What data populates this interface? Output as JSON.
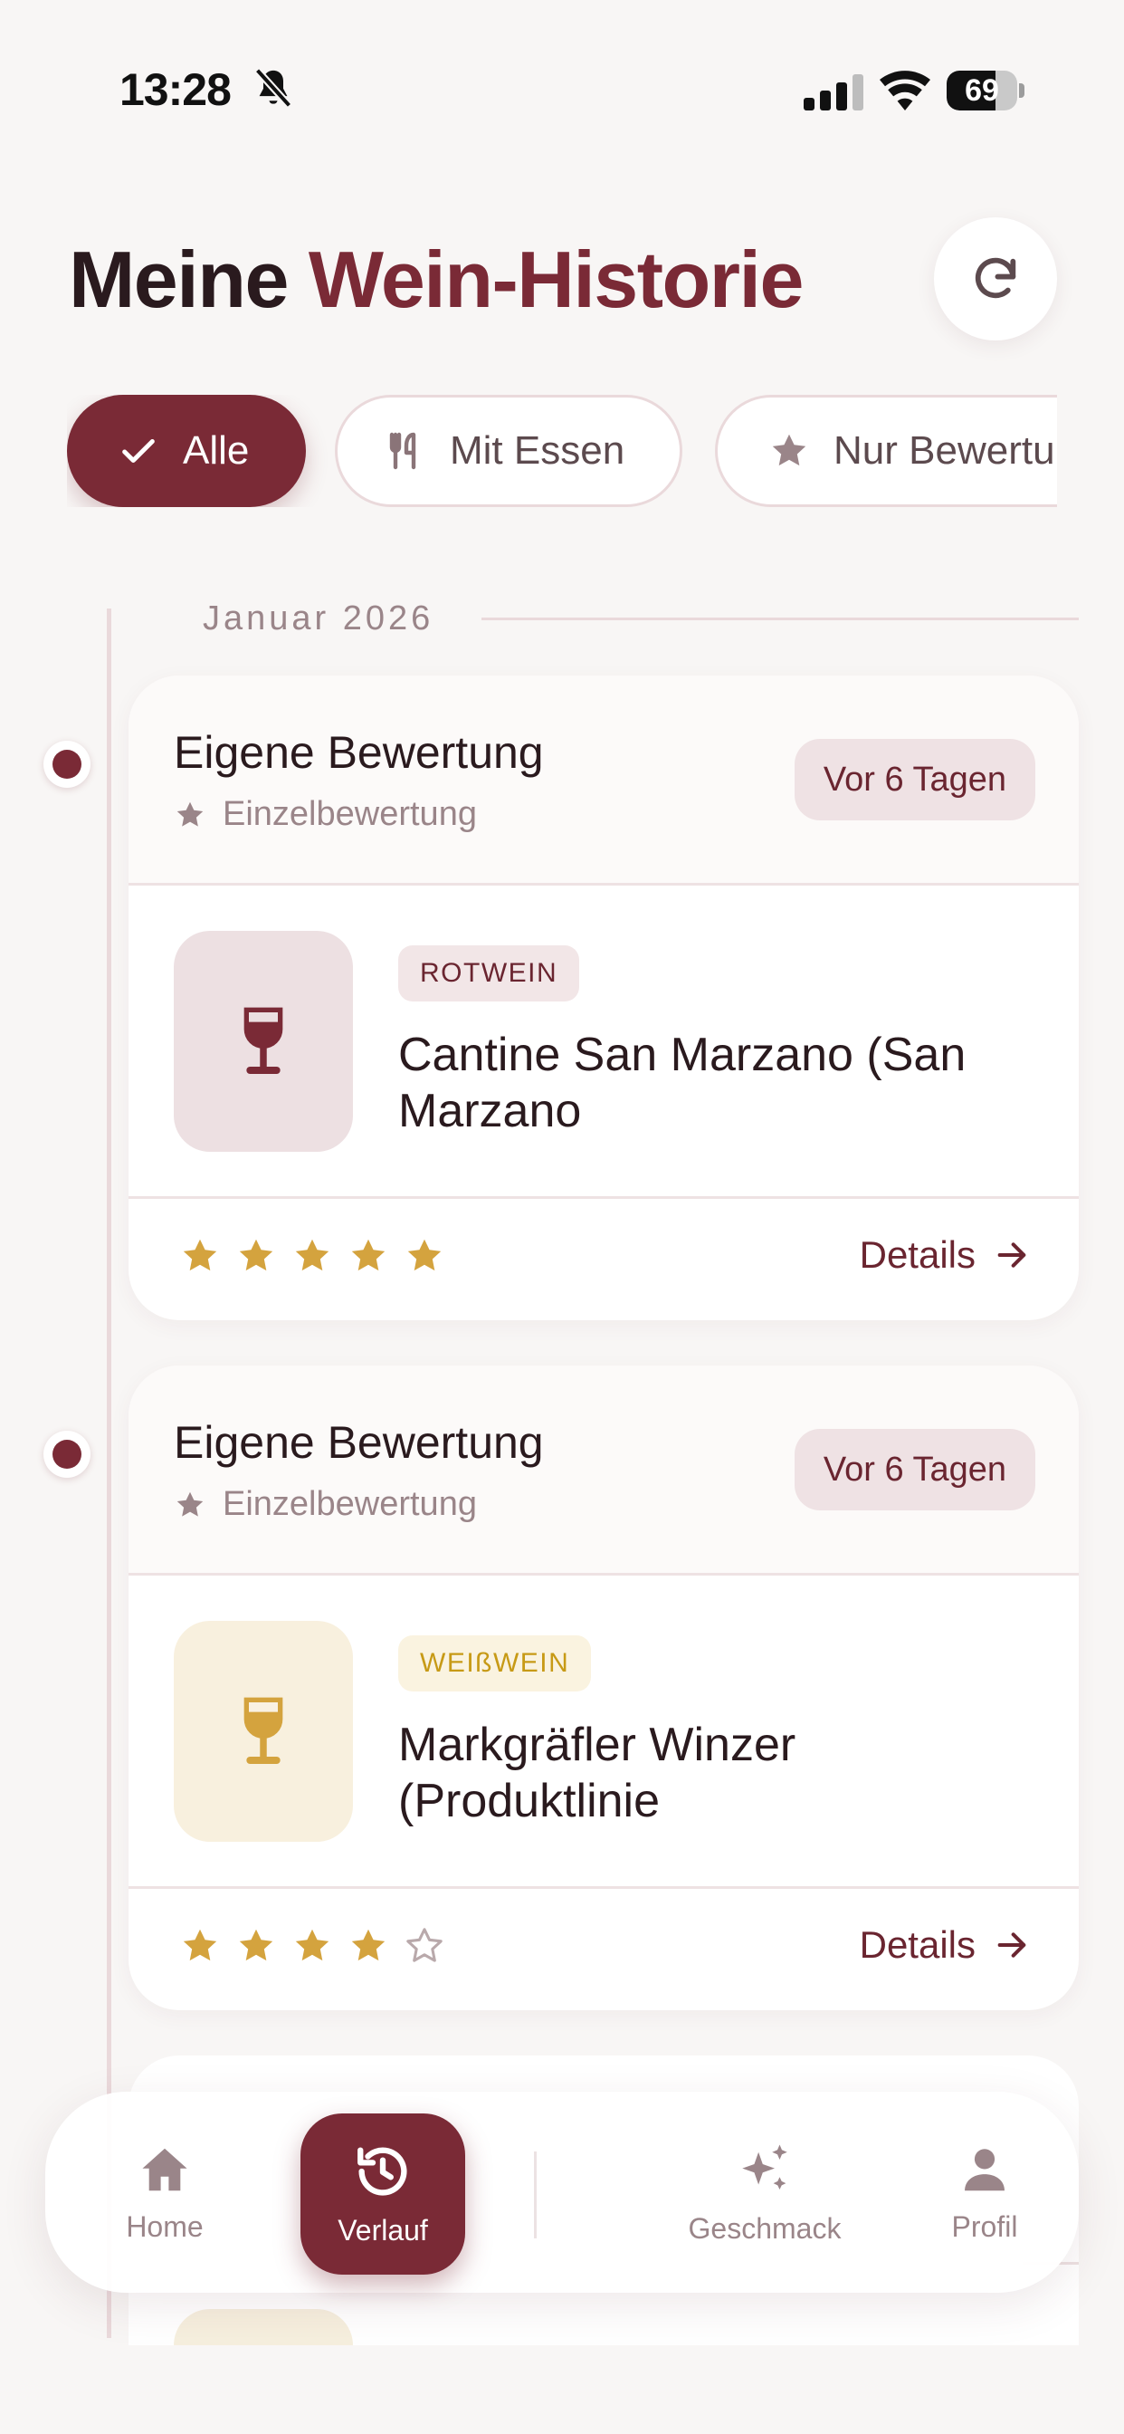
{
  "status": {
    "time": "13:28",
    "battery": "69",
    "battery_level": 0.69
  },
  "header": {
    "title_part1": "Meine ",
    "title_part2": "Wein-Historie",
    "refresh_icon": "refresh-icon"
  },
  "filters": [
    {
      "label": "Alle",
      "icon": "check-icon",
      "active": true
    },
    {
      "label": "Mit Essen",
      "icon": "utensils-icon",
      "active": false
    },
    {
      "label": "Nur Bewertu",
      "icon": "star-icon",
      "active": false
    }
  ],
  "timeline": {
    "month": "Januar 2026"
  },
  "entries": [
    {
      "title": "Eigene Bewertung",
      "subtitle": "Einzelbewertung",
      "badge": "Vor 6 Tagen",
      "type": "ROTWEIN",
      "type_color": "#6a2530",
      "type_bg": "#f2e6e7",
      "thumb_bg": "#ede0e2",
      "glass_color": "#7a2a36",
      "name": "Cantine San Marzano (San Marzano",
      "rating": 5,
      "details": "Details"
    },
    {
      "title": "Eigene Bewertung",
      "subtitle": "Einzelbewertung",
      "badge": "Vor 6 Tagen",
      "type": "WEIßWEIN",
      "type_color": "#c79a16",
      "type_bg": "#faf3e0",
      "thumb_bg": "#f8f0de",
      "glass_color": "#d4a33e",
      "name": "Markgräfler Winzer (Produktlinie",
      "rating": 4,
      "details": "Details"
    }
  ],
  "nav": [
    {
      "label": "Home",
      "icon": "home-icon",
      "active": false
    },
    {
      "label": "Verlauf",
      "icon": "history-icon",
      "active": true
    },
    {
      "label": "Geschmack",
      "icon": "sparkles-icon",
      "active": false
    },
    {
      "label": "Profil",
      "icon": "person-icon",
      "active": false
    }
  ],
  "colors": {
    "accent": "#7a2a36",
    "star": "#d4a33e",
    "background": "#f8f6f5"
  }
}
